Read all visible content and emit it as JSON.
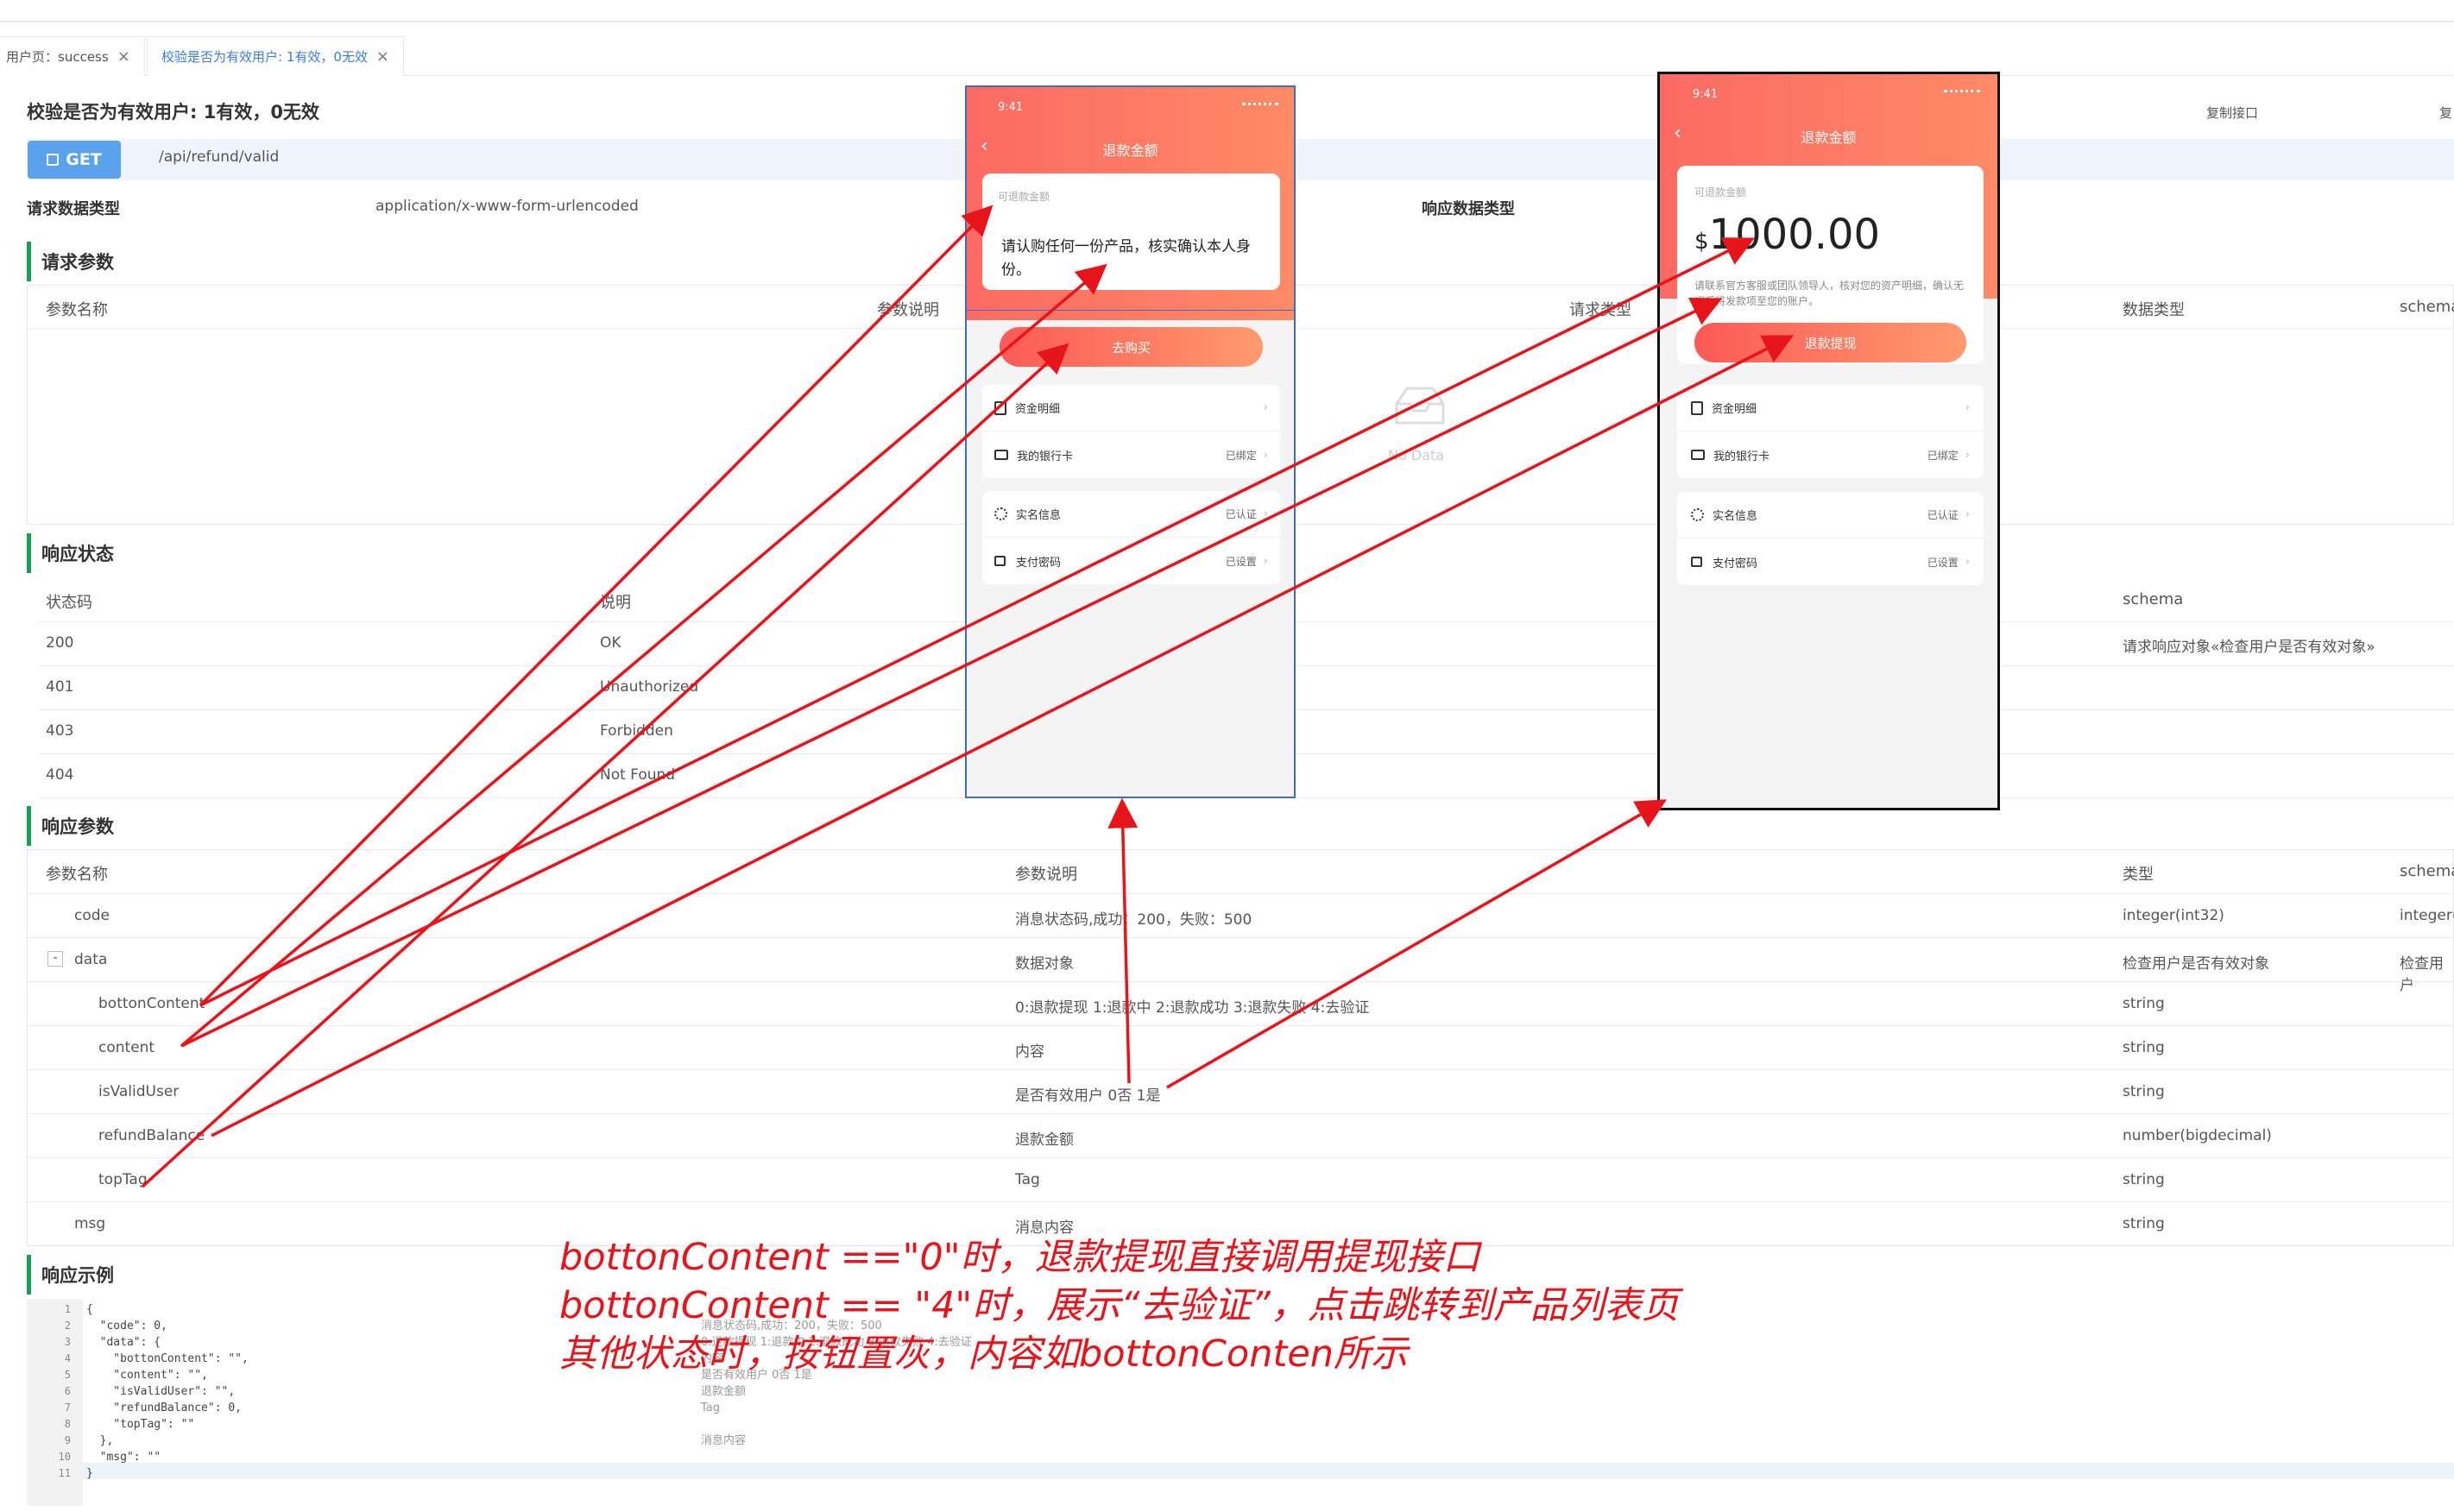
{
  "tabs": [
    {
      "label": "用户页：success"
    },
    {
      "label": "校验是否为有效用户: 1有效，0无效"
    }
  ],
  "page_title": "校验是否为有效用户: 1有效，0无效",
  "copy_label": "复制接口",
  "copy_label_cut": "复",
  "method": "GET",
  "url": "/api/refund/valid",
  "req_type_label": "请求数据类型",
  "req_type_value": "application/x-www-form-urlencoded",
  "resp_type_label": "响应数据类型",
  "sections": {
    "req_params": "请求参数",
    "resp_status": "响应状态",
    "resp_params": "响应参数",
    "resp_example": "响应示例"
  },
  "req_params_headers": [
    "参数名称",
    "参数说明",
    "请求类型",
    "数据类型",
    "schema"
  ],
  "no_data": "No Data",
  "status_headers": [
    "状态码",
    "说明",
    "schema"
  ],
  "status_rows": [
    {
      "code": "200",
      "desc": "OK",
      "schema": "请求响应对象«检查用户是否有效对象»"
    },
    {
      "code": "401",
      "desc": "Unauthorized",
      "schema": ""
    },
    {
      "code": "403",
      "desc": "Forbidden",
      "schema": ""
    },
    {
      "code": "404",
      "desc": "Not Found",
      "schema": ""
    }
  ],
  "resp_headers": [
    "参数名称",
    "参数说明",
    "类型",
    "schema"
  ],
  "resp_rows": [
    {
      "name": "code",
      "desc": "消息状态码,成功：200，失败：500",
      "type": "integer(int32)",
      "schema": "integer("
    },
    {
      "name": "data",
      "desc": "数据对象",
      "type": "检查用户是否有效对象",
      "schema": "检查用户"
    },
    {
      "name": "bottonContent",
      "desc": "0:退款提现 1:退款中 2:退款成功 3:退款失败 4:去验证",
      "type": "string",
      "schema": ""
    },
    {
      "name": "content",
      "desc": "内容",
      "type": "string",
      "schema": ""
    },
    {
      "name": "isValidUser",
      "desc": "是否有效用户 0否 1是",
      "type": "string",
      "schema": ""
    },
    {
      "name": "refundBalance",
      "desc": "退款金额",
      "type": "number(bigdecimal)",
      "schema": ""
    },
    {
      "name": "topTag",
      "desc": "Tag",
      "type": "string",
      "schema": ""
    },
    {
      "name": "msg",
      "desc": "消息内容",
      "type": "string",
      "schema": ""
    }
  ],
  "expand_toggle": "-",
  "code_lines": [
    "{",
    "  \"code\": 0,",
    "  \"data\": {",
    "    \"bottonContent\": \"\",",
    "    \"content\": \"\",",
    "    \"isValidUser\": \"\",",
    "    \"refundBalance\": 0,",
    "    \"topTag\": \"\"",
    "  },",
    "  \"msg\": \"\"",
    "}"
  ],
  "line_numbers": [
    "1",
    "2",
    "3",
    "4",
    "5",
    "6",
    "7",
    "8",
    "9",
    "10",
    "11"
  ],
  "code_comments": [
    "消息状态码,成功：200，失败：500",
    "0:退款提现 1:退款中 2:退款成功 3:退款失败 4:去验证",
    "内容",
    "是否有效用户 0否 1是",
    "退款金额",
    "Tag",
    "消息内容"
  ],
  "phone1": {
    "time": "9:41",
    "title": "退款金额",
    "card_label": "可退款金额",
    "card_msg": "请认购任何一份产品，核实确认本人身份。",
    "button": "去购买",
    "menu": [
      {
        "label": "资金明细",
        "value": ""
      },
      {
        "label": "我的银行卡",
        "value": "已绑定"
      },
      {
        "label": "实名信息",
        "value": "已认证"
      },
      {
        "label": "支付密码",
        "value": "已设置"
      }
    ]
  },
  "phone2": {
    "time": "9:41",
    "title": "退款金额",
    "card_label": "可退款金额",
    "currency": "$",
    "amount": "1000.00",
    "note": "请联系官方客服或团队领导人，核对您的资产明细，确认无误后将发款项至您的账户。",
    "button": "退款提现",
    "menu": [
      {
        "label": "资金明细",
        "value": ""
      },
      {
        "label": "我的银行卡",
        "value": "已绑定"
      },
      {
        "label": "实名信息",
        "value": "已认证"
      },
      {
        "label": "支付密码",
        "value": "已设置"
      }
    ]
  },
  "annotations": [
    "bottonContent ==\"0\"时，退款提现直接调用提现接口",
    "bottonContent == \"4\"时，展示“去验证”，点击跳转到产品列表页",
    "其他状态时，按钮置灰，内容如bottonConten所示"
  ],
  "colors": {
    "accent": "#18a058",
    "get": "#5aa3ec",
    "phone_red": "#fb6a63",
    "annotation": "#e8141b"
  }
}
